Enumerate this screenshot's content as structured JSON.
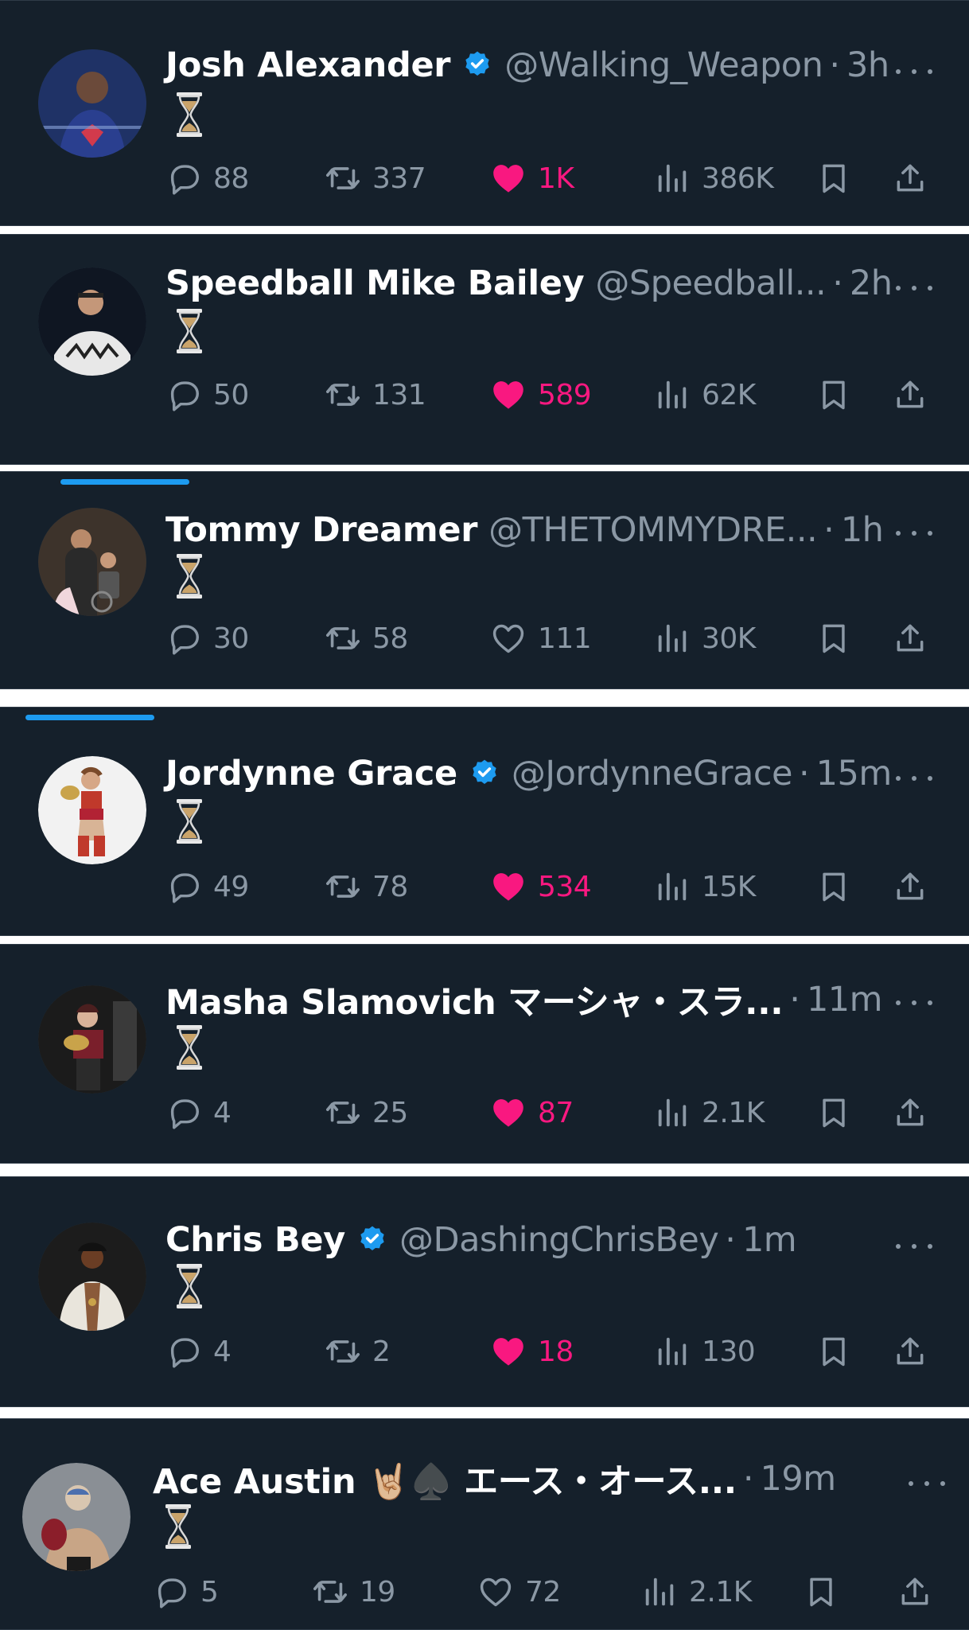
{
  "colors": {
    "background": "#15202b",
    "separator": "#ffffff",
    "accent": "#1d9bf0",
    "like": "#f91880",
    "muted": "#8b98a5"
  },
  "icons": {
    "reply": "reply-icon",
    "repost": "repost-icon",
    "like": "heart-icon",
    "views": "views-icon",
    "bookmark": "bookmark-icon",
    "share": "share-icon",
    "more": "more-icon",
    "verified": "verified-badge-icon",
    "tweet_content": "hourglass-emoji"
  },
  "tweets": [
    {
      "name": "Josh Alexander",
      "verified": true,
      "handle": "@Walking_Weapon",
      "separator": "·",
      "time": "3h",
      "content_emoji": "hourglass",
      "replies": "88",
      "reposts": "337",
      "likes": "1K",
      "liked": true,
      "views": "386K"
    },
    {
      "name": "Speedball Mike Bailey",
      "verified": false,
      "handle": "@Speedball...",
      "separator": "·",
      "time": "2h",
      "content_emoji": "hourglass",
      "replies": "50",
      "reposts": "131",
      "likes": "589",
      "liked": true,
      "views": "62K"
    },
    {
      "name": "Tommy Dreamer",
      "verified": false,
      "handle": "@THETOMMYDRE...",
      "separator": "·",
      "time": "1h",
      "content_emoji": "hourglass",
      "replies": "30",
      "reposts": "58",
      "likes": "111",
      "liked": false,
      "views": "30K"
    },
    {
      "name": "Jordynne Grace",
      "verified": true,
      "handle": "@JordynneGrace",
      "separator": "·",
      "time": "15m",
      "content_emoji": "hourglass",
      "replies": "49",
      "reposts": "78",
      "likes": "534",
      "liked": true,
      "views": "15K"
    },
    {
      "name": "Masha Slamovich マーシャ・スラ...",
      "verified": false,
      "handle": "",
      "separator": "·",
      "time": "11m",
      "content_emoji": "hourglass",
      "replies": "4",
      "reposts": "25",
      "likes": "87",
      "liked": true,
      "views": "2.1K"
    },
    {
      "name": "Chris Bey",
      "verified": true,
      "handle": "@DashingChrisBey",
      "separator": "·",
      "time": "1m",
      "content_emoji": "hourglass",
      "replies": "4",
      "reposts": "2",
      "likes": "18",
      "liked": true,
      "views": "130"
    },
    {
      "name": "Ace Austin 🤘🏼♠️ エース・オース...",
      "verified": false,
      "handle": "",
      "separator": "·",
      "time": "19m",
      "content_emoji": "hourglass",
      "replies": "5",
      "reposts": "19",
      "likes": "72",
      "liked": false,
      "views": "2.1K"
    }
  ]
}
